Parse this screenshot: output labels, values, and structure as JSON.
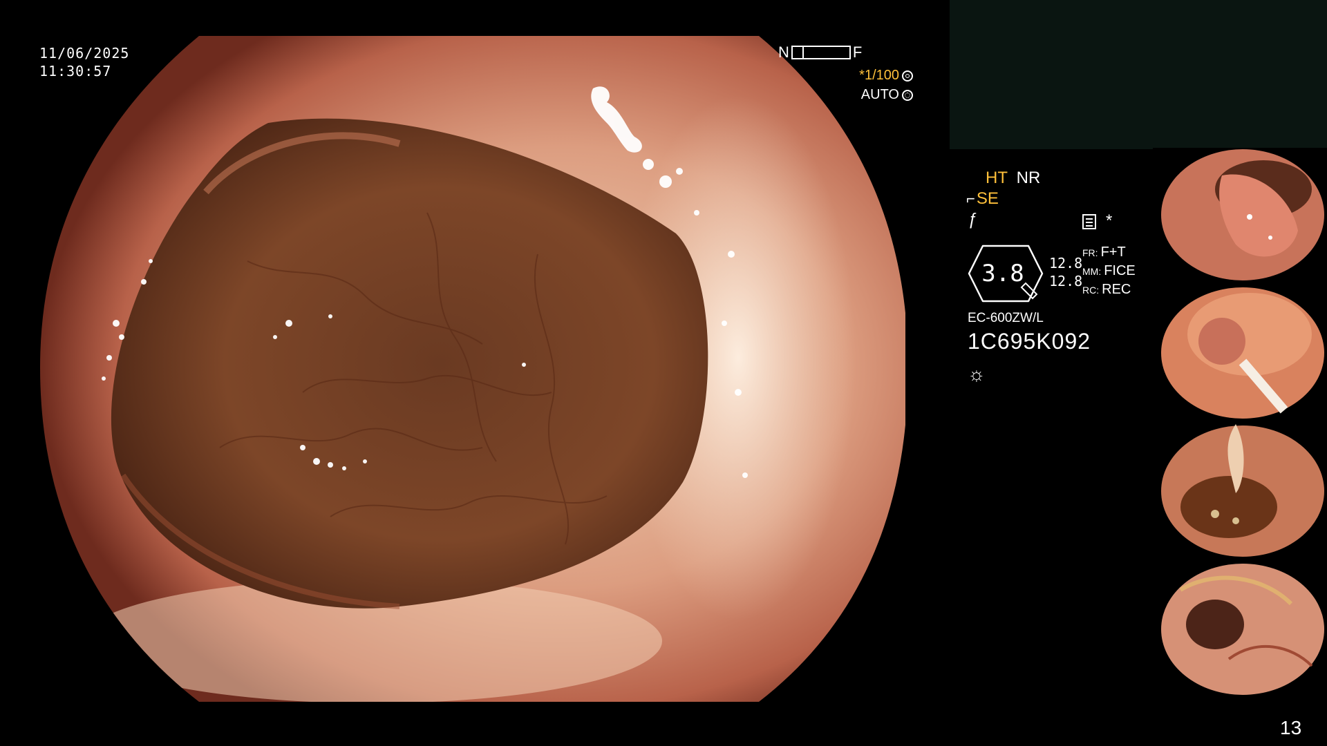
{
  "overlay": {
    "date": "11/06/2025",
    "time": "11:30:57",
    "nf_near": "N",
    "nf_far": "F",
    "shutter": "*1/100",
    "exposure_mode": "AUTO"
  },
  "settings": {
    "ht": "HT",
    "nr": "NR",
    "se": "SE",
    "zoom_value": "3.8",
    "ratio_1": "12.8",
    "ratio_2": "12.8",
    "modes": [
      {
        "key": "FR:",
        "value": "F+T"
      },
      {
        "key": "MM:",
        "value": "FICE"
      },
      {
        "key": "RC:",
        "value": "REC"
      }
    ],
    "scope_model": "EC-600ZW/L",
    "scope_serial": "1C695K092"
  },
  "icons": {
    "shutter_icon": "aperture-icon",
    "auto_icon": "flower-icon",
    "memo_icon": "memo-icon",
    "star_icon": "asterisk-icon",
    "light_icon": "light-source-icon",
    "se_icon": "se-glyph-icon",
    "f_icon": "f-glyph-icon"
  },
  "colors": {
    "accent": "#ffc03a",
    "background": "#000000",
    "panel": "#0a1511"
  },
  "page_number": "13"
}
